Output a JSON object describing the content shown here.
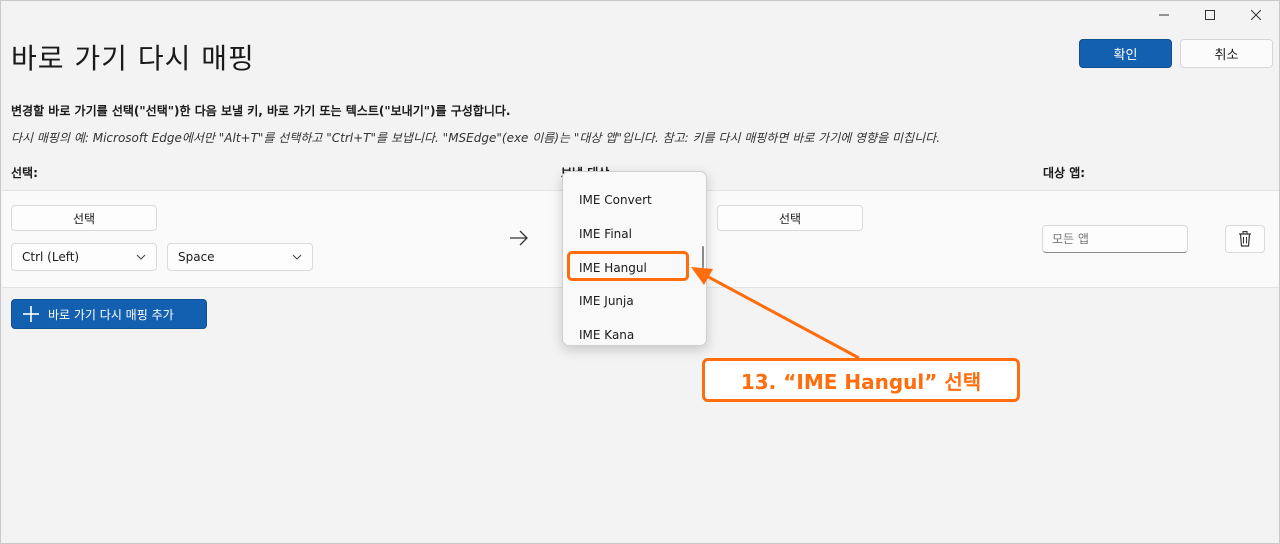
{
  "window": {
    "title": "바로 가기 다시 매핑",
    "controls": [
      "minimize-icon",
      "maximize-icon",
      "close-icon"
    ]
  },
  "header": {
    "ok_label": "확인",
    "cancel_label": "취소"
  },
  "description": {
    "main": "변경할 바로 가기를 선택(\"선택\")한 다음 보낼 키, 바로 가기 또는 텍스트(\"보내기\")를 구성합니다.",
    "example": "다시 매핑의 예: Microsoft Edge에서만 \"Alt+T\"를 선택하고 \"Ctrl+T\"를 보냅니다. \"MSEdge\"(exe 이름)는 \"대상 앱\"입니다. 참고: 키를 다시 매핑하면 바로 가기에 영향을 미칩니다."
  },
  "columns": {
    "select": "선택:",
    "send_to": "보낼 대상",
    "target_app": "대상 앱:"
  },
  "row": {
    "select_button": "선택",
    "key1": "Ctrl (Left)",
    "key2": "Space",
    "send_select_button": "선택",
    "target_app_placeholder": "모든 앱"
  },
  "add_button_label": "바로 가기 다시 매핑 추가",
  "dropdown": {
    "items": [
      "IME Convert",
      "IME Final",
      "IME Hangul",
      "IME Junja",
      "IME Kana"
    ],
    "selected": "IME Hangul"
  },
  "annotation": {
    "text": "13. “IME Hangul” 선택",
    "color": "#ff6d0c"
  },
  "colors": {
    "accent": "#1460b0",
    "annotation": "#ff6d0c"
  }
}
